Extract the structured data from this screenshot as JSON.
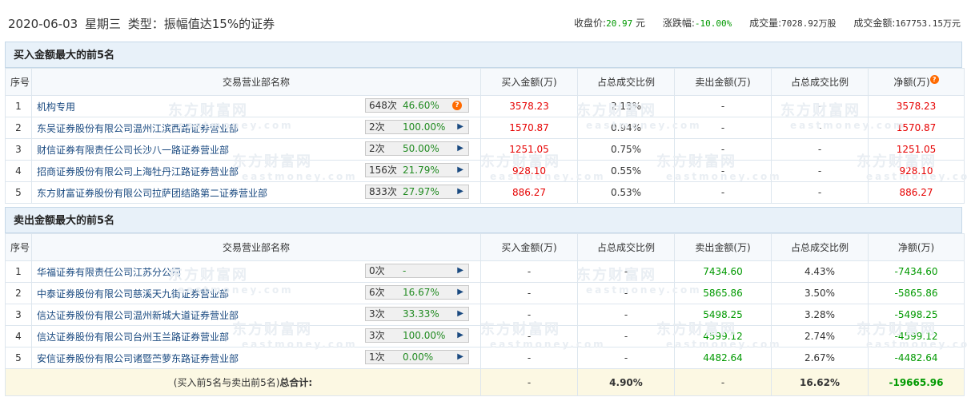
{
  "header": {
    "date": "2020-06-03",
    "weekday": "星期三",
    "type_label": "类型：振幅值达15%的证券",
    "close_label": "收盘价:",
    "close_value": "20.97",
    "close_unit": "元",
    "change_label": "涨跌幅:",
    "change_value": "-10.00%",
    "volume_label": "成交量:",
    "volume_value": "7028.92万股",
    "amount_label": "成交金额:",
    "amount_value": "167753.15万元"
  },
  "watermark": {
    "cn": "东方财富网",
    "en": "eastmoney.com"
  },
  "buy": {
    "title": "买入金额最大的前5名",
    "headers": [
      "序号",
      "交易营业部名称",
      "买入金额(万)",
      "占总成交比例",
      "卖出金额(万)",
      "占总成交比例",
      "净额(万)"
    ],
    "rows": [
      {
        "idx": "1",
        "name": "机构专用",
        "count": "648次",
        "pct": "46.60%",
        "buy": "3578.23",
        "buy_ratio": "2.13%",
        "sell": "-",
        "sell_ratio": "-",
        "net": "3578.23"
      },
      {
        "idx": "2",
        "name": "东吴证券股份有限公司温州江滨西路证券营业部",
        "count": "2次",
        "pct": "100.00%",
        "buy": "1570.87",
        "buy_ratio": "0.94%",
        "sell": "-",
        "sell_ratio": "-",
        "net": "1570.87"
      },
      {
        "idx": "3",
        "name": "财信证券有限责任公司长沙八一路证券营业部",
        "count": "2次",
        "pct": "50.00%",
        "buy": "1251.05",
        "buy_ratio": "0.75%",
        "sell": "-",
        "sell_ratio": "-",
        "net": "1251.05"
      },
      {
        "idx": "4",
        "name": "招商证券股份有限公司上海牡丹江路证券营业部",
        "count": "156次",
        "pct": "21.79%",
        "buy": "928.10",
        "buy_ratio": "0.55%",
        "sell": "-",
        "sell_ratio": "-",
        "net": "928.10"
      },
      {
        "idx": "5",
        "name": "东方财富证券股份有限公司拉萨团结路第二证券营业部",
        "count": "833次",
        "pct": "27.97%",
        "buy": "886.27",
        "buy_ratio": "0.53%",
        "sell": "-",
        "sell_ratio": "-",
        "net": "886.27"
      }
    ]
  },
  "sell": {
    "title": "卖出金额最大的前5名",
    "headers": [
      "序号",
      "交易营业部名称",
      "买入金额(万)",
      "占总成交比例",
      "卖出金额(万)",
      "占总成交比例",
      "净额(万)"
    ],
    "rows": [
      {
        "idx": "1",
        "name": "华福证券有限责任公司江苏分公司",
        "count": "0次",
        "pct": "-",
        "buy": "-",
        "buy_ratio": "-",
        "sell": "7434.60",
        "sell_ratio": "4.43%",
        "net": "-7434.60"
      },
      {
        "idx": "2",
        "name": "中泰证券股份有限公司慈溪天九街证券营业部",
        "count": "6次",
        "pct": "16.67%",
        "buy": "-",
        "buy_ratio": "-",
        "sell": "5865.86",
        "sell_ratio": "3.50%",
        "net": "-5865.86"
      },
      {
        "idx": "3",
        "name": "信达证券股份有限公司温州新城大道证券营业部",
        "count": "3次",
        "pct": "33.33%",
        "buy": "-",
        "buy_ratio": "-",
        "sell": "5498.25",
        "sell_ratio": "3.28%",
        "net": "-5498.25"
      },
      {
        "idx": "4",
        "name": "信达证券股份有限公司台州玉兰路证券营业部",
        "count": "3次",
        "pct": "100.00%",
        "buy": "-",
        "buy_ratio": "-",
        "sell": "4599.12",
        "sell_ratio": "2.74%",
        "net": "-4599.12"
      },
      {
        "idx": "5",
        "name": "安信证券股份有限公司诸暨苎萝东路证券营业部",
        "count": "1次",
        "pct": "0.00%",
        "buy": "-",
        "buy_ratio": "-",
        "sell": "4482.64",
        "sell_ratio": "2.67%",
        "net": "-4482.64"
      }
    ]
  },
  "total": {
    "label_prefix": "(买入前5名与卖出前5名)",
    "label_bold": "总合计:",
    "buy": "-",
    "buy_ratio": "4.90%",
    "sell": "-",
    "sell_ratio": "16.62%",
    "net": "-19665.96"
  },
  "colors": {
    "buy": "#e60000",
    "sell": "#009900",
    "header_bg": "#e8f1f9",
    "total_bg": "#fcf8e3"
  },
  "icons": {
    "info": "question-bubble-icon",
    "expand": "triangle-right-icon"
  }
}
